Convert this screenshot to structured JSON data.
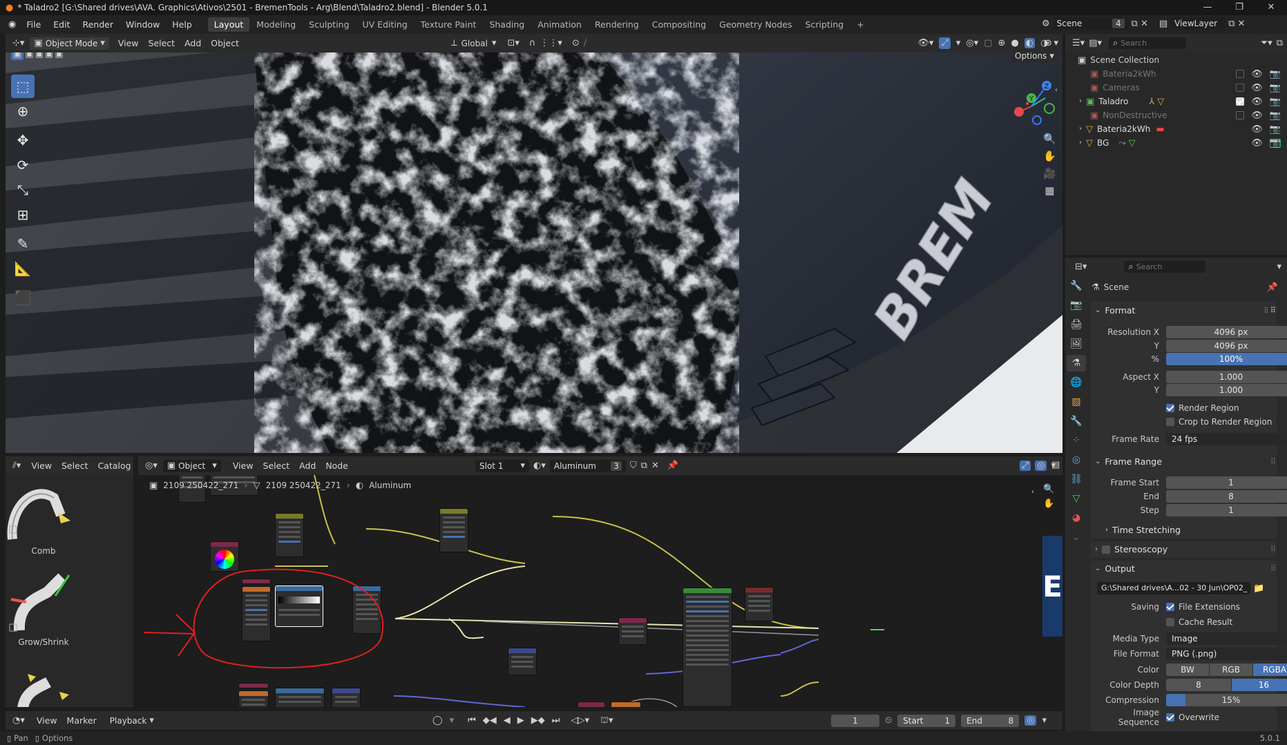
{
  "titlebar": {
    "title": "* Taladro2 [G:\\Shared drives\\AVA. Graphics\\Ativos\\2501 - BremenTools - Arg\\Blend\\Taladro2.blend] - Blender 5.0.1",
    "minimize": "—",
    "maximize": "❐",
    "close": "✕"
  },
  "menu": [
    "File",
    "Edit",
    "Render",
    "Window",
    "Help"
  ],
  "workspaces": [
    "Layout",
    "Modeling",
    "Sculpting",
    "UV Editing",
    "Texture Paint",
    "Shading",
    "Animation",
    "Rendering",
    "Compositing",
    "Geometry Nodes",
    "Scripting"
  ],
  "active_workspace": "Layout",
  "add_workspace": "+",
  "scene": {
    "name": "Scene",
    "count": "4"
  },
  "view_layer": "ViewLayer",
  "viewport": {
    "mode": "Object Mode",
    "menus": [
      "View",
      "Select",
      "Add",
      "Object"
    ],
    "transform_orientation": "Global",
    "options_label": "Options",
    "gizmo": {
      "x": "X",
      "y": "Y",
      "z": "Z"
    },
    "text_in_scene": "BREM"
  },
  "outliner": {
    "search_placeholder": "Search",
    "root": "Scene Collection",
    "items": [
      {
        "name": "Bateria2kWh",
        "dim": true,
        "expand": false
      },
      {
        "name": "Cameras",
        "dim": true,
        "expand": false
      },
      {
        "name": "Taladro",
        "dim": false,
        "expand": true
      },
      {
        "name": "NonDestructive",
        "dim": true,
        "expand": false
      },
      {
        "name": "Bateria2kWh",
        "dim": false,
        "expand": true
      },
      {
        "name": "BG",
        "dim": false,
        "expand": true
      }
    ]
  },
  "properties": {
    "search_placeholder": "Search",
    "context": "Scene",
    "format": {
      "title": "Format",
      "resolution_x_label": "Resolution X",
      "resolution_x": "4096 px",
      "y_label": "Y",
      "resolution_y": "4096 px",
      "pct_label": "%",
      "pct": "100%",
      "aspect_x_label": "Aspect X",
      "aspect_x": "1.000",
      "aspect_y_label": "Y",
      "aspect_y": "1.000",
      "render_region": "Render Region",
      "crop": "Crop to Render Region",
      "frame_rate_label": "Frame Rate",
      "frame_rate": "24 fps"
    },
    "frame_range": {
      "title": "Frame Range",
      "start_label": "Frame Start",
      "start": "1",
      "end_label": "End",
      "end": "8",
      "step_label": "Step",
      "step": "1",
      "time_stretching": "Time Stretching"
    },
    "stereoscopy": "Stereoscopy",
    "output": {
      "title": "Output",
      "path": "G:\\Shared drives\\A...02 - 30 Jun\\OP02_",
      "saving_label": "Saving",
      "file_extensions": "File Extensions",
      "cache_result": "Cache Result",
      "media_type_label": "Media Type",
      "media_type": "Image",
      "file_format_label": "File Format",
      "file_format": "PNG (.png)",
      "color_label": "Color",
      "color_opts": [
        "BW",
        "RGB",
        "RGBA"
      ],
      "color_depth_label": "Color Depth",
      "depth_opts": [
        "8",
        "16"
      ],
      "compression_label": "Compression",
      "compression": "15%",
      "compression_value": 0.15,
      "image_sequence_label": "Image Sequence",
      "overwrite": "Overwrite"
    }
  },
  "asset_browser": {
    "menus": [
      "View",
      "Select",
      "Catalog"
    ],
    "brushes": [
      "Comb",
      "Grow/Shrink"
    ]
  },
  "node_editor": {
    "type": "Object",
    "menus": [
      "View",
      "Select",
      "Add",
      "Node"
    ],
    "slot": "Slot 1",
    "material": "Aluminum",
    "users": "3",
    "breadcrumb": [
      "2109 250422_271",
      "2109 250422_271",
      "Aluminum"
    ]
  },
  "timeline": {
    "menus": [
      "View",
      "Marker",
      "Playback"
    ],
    "current_frame": "1",
    "start_label": "Start",
    "start": "1",
    "end_label": "End",
    "end": "8"
  },
  "statusbar": {
    "hint1": "Pan",
    "hint2": "Options",
    "version": "5.0.1"
  },
  "colors": {
    "accent": "#4772b3",
    "header": "#2b2b2b",
    "panel": "#303030",
    "annotation": "#e02020"
  }
}
